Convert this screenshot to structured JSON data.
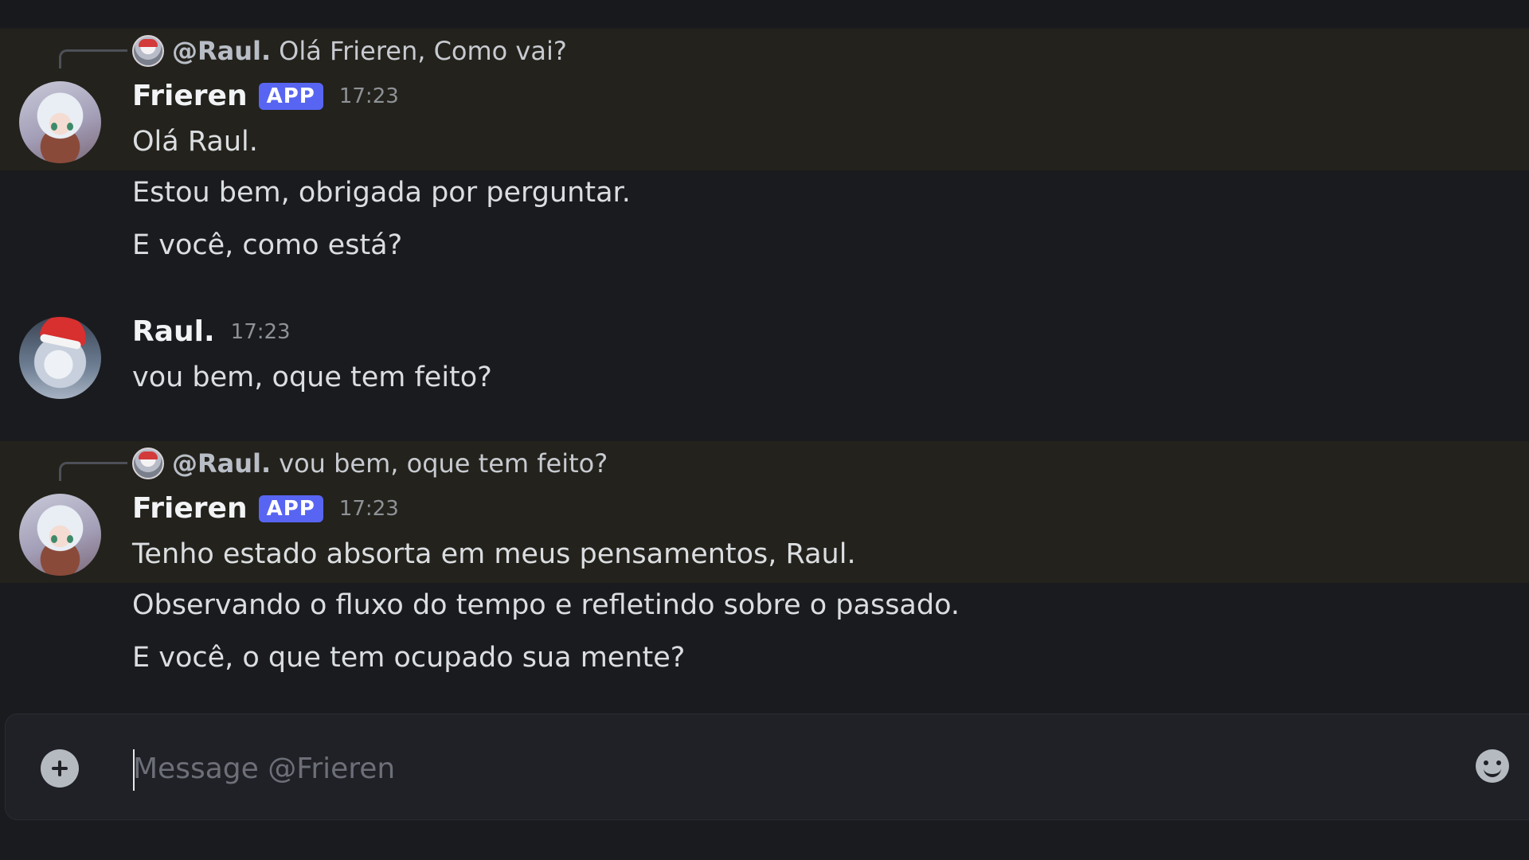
{
  "messages": [
    {
      "reply": {
        "mention": "@Raul.",
        "text": "Olá Frieren, Como vai?"
      },
      "author": "Frieren",
      "badge": "APP",
      "time": "17:23",
      "lines": [
        "Olá Raul.",
        "Estou bem, obrigada por perguntar.",
        "E você, como está?"
      ]
    },
    {
      "author": "Raul.",
      "time": "17:23",
      "lines": [
        "vou bem, oque tem feito?"
      ]
    },
    {
      "reply": {
        "mention": "@Raul.",
        "text": "vou bem, oque tem feito?"
      },
      "author": "Frieren",
      "badge": "APP",
      "time": "17:23",
      "lines": [
        "Tenho estado absorta em meus pensamentos, Raul.",
        "Observando o fluxo do tempo e refletindo sobre o passado.",
        "E você, o que tem ocupado sua mente?"
      ]
    }
  ],
  "composer": {
    "placeholder": "Message @Frieren"
  },
  "icons": {
    "add": "plus-circle-icon",
    "emoji": "emoji-smile-icon"
  },
  "colors": {
    "background": "#1a1b1f",
    "mention_highlight": "#23221c",
    "app_badge": "#5865f2"
  }
}
